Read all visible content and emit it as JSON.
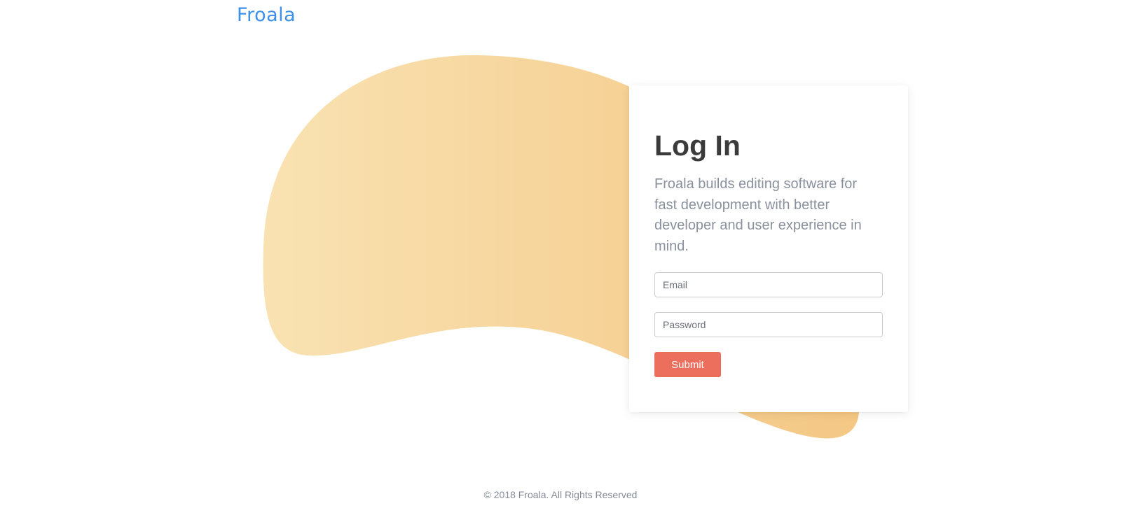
{
  "brand": {
    "logo_text": "Froala",
    "logo_color": "#3d8fe8"
  },
  "login": {
    "title": "Log In",
    "description": "Froala builds editing software for fast development with better developer and user experience in mind.",
    "email_placeholder": "Email",
    "password_placeholder": "Password",
    "submit_label": "Submit",
    "submit_color": "#ec6e5c"
  },
  "decor": {
    "blob_gradient": [
      "#f9e2b2",
      "#f4c784"
    ]
  },
  "footer": {
    "copyright": "© 2018 Froala. All Rights Reserved"
  }
}
